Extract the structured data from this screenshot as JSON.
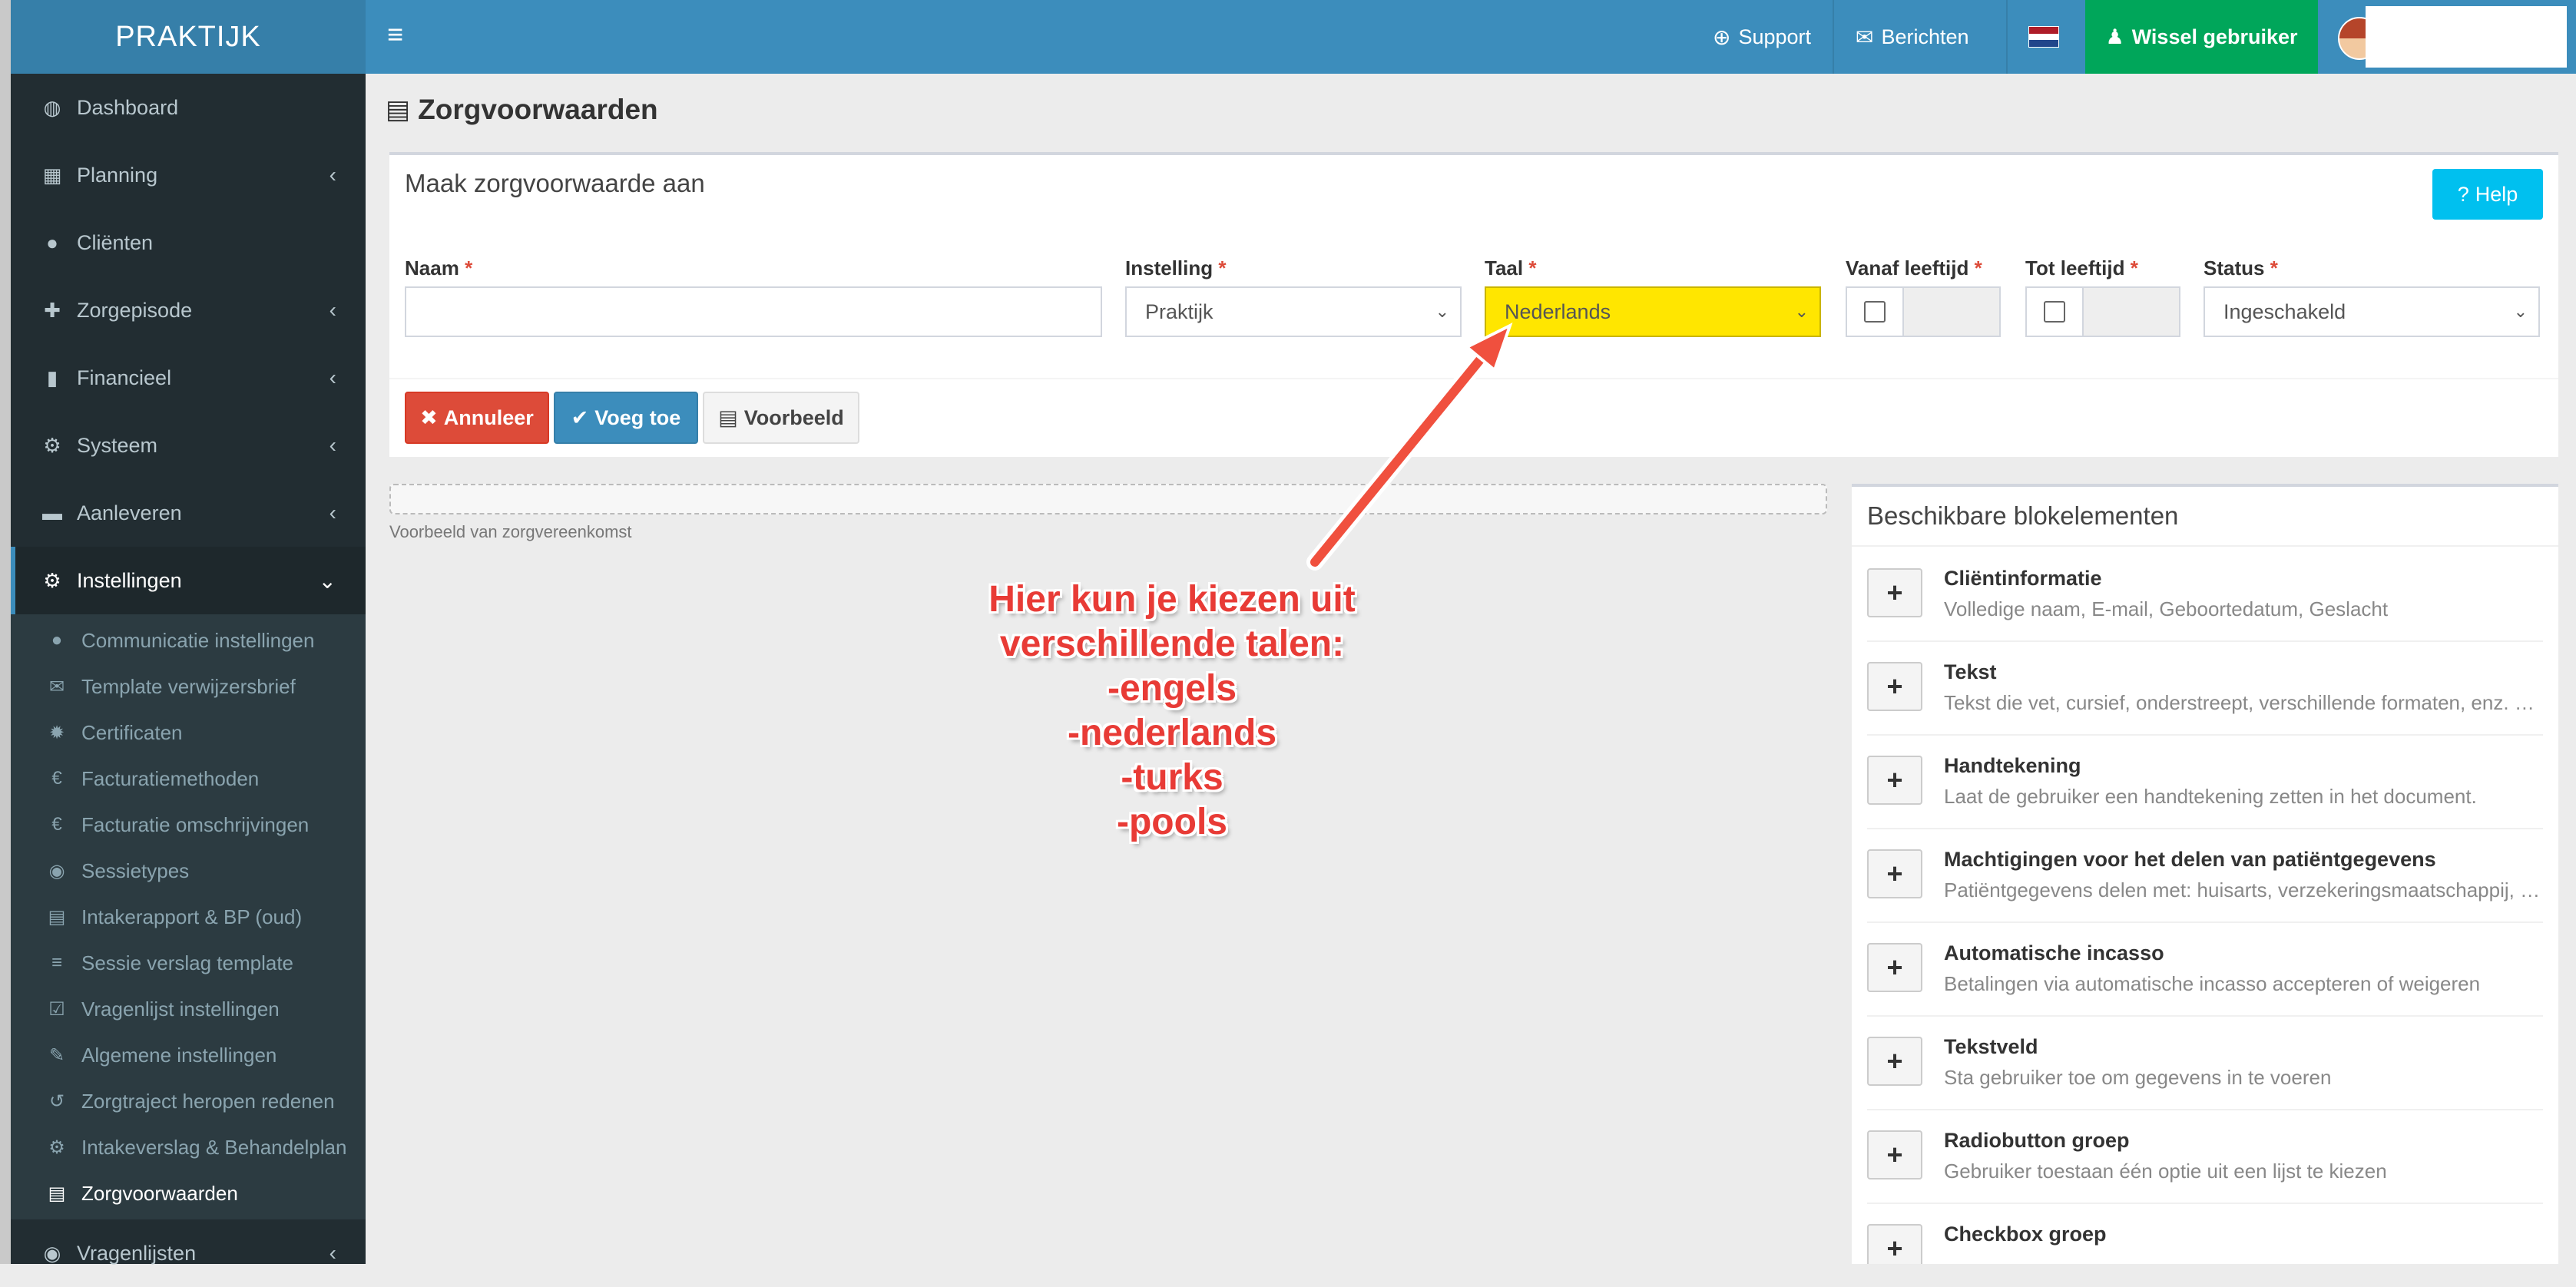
{
  "sidebar": {
    "brand": "PRAKTIJK",
    "items": [
      {
        "label": "Dashboard",
        "icon": "dashboard-icon",
        "glyph": "◍",
        "chevron": ""
      },
      {
        "label": "Planning",
        "icon": "calendar-icon",
        "glyph": "▦",
        "chevron": "‹"
      },
      {
        "label": "Cliënten",
        "icon": "user-icon",
        "glyph": "●",
        "chevron": ""
      },
      {
        "label": "Zorgepisode",
        "icon": "medkit-icon",
        "glyph": "✚",
        "chevron": "‹"
      },
      {
        "label": "Financieel",
        "icon": "book-icon",
        "glyph": "▮",
        "chevron": "‹"
      },
      {
        "label": "Systeem",
        "icon": "cogs-icon",
        "glyph": "⚙",
        "chevron": "‹"
      },
      {
        "label": "Aanleveren",
        "icon": "truck-icon",
        "glyph": "▬",
        "chevron": "‹"
      },
      {
        "label": "Instellingen",
        "icon": "gear-icon",
        "glyph": "⚙",
        "chevron": "⌄"
      }
    ],
    "submenu": [
      {
        "label": "Communicatie instellingen",
        "icon": "comments-icon",
        "glyph": "●"
      },
      {
        "label": "Template verwijzersbrief",
        "icon": "envelope-icon",
        "glyph": "✉"
      },
      {
        "label": "Certificaten",
        "icon": "certificate-icon",
        "glyph": "✹"
      },
      {
        "label": "Facturatiemethoden",
        "icon": "euro-icon",
        "glyph": "€"
      },
      {
        "label": "Facturatie omschrijvingen",
        "icon": "euro-icon",
        "glyph": "€"
      },
      {
        "label": "Sessietypes",
        "icon": "globe-icon",
        "glyph": "◉"
      },
      {
        "label": "Intakerapport & BP (oud)",
        "icon": "file-icon",
        "glyph": "▤"
      },
      {
        "label": "Sessie verslag template",
        "icon": "database-icon",
        "glyph": "≡"
      },
      {
        "label": "Vragenlijst instellingen",
        "icon": "check-square-icon",
        "glyph": "☑"
      },
      {
        "label": "Algemene instellingen",
        "icon": "wrench-icon",
        "glyph": "✎"
      },
      {
        "label": "Zorgtraject heropen redenen",
        "icon": "undo-icon",
        "glyph": "↺"
      },
      {
        "label": "Intakeverslag & Behandelplan",
        "icon": "cog-icon",
        "glyph": "⚙"
      },
      {
        "label": "Zorgvoorwaarden",
        "icon": "file-pdf-icon",
        "glyph": "▤"
      }
    ],
    "bottom_item": {
      "label": "Vragenlijsten",
      "icon": "globe-icon",
      "glyph": "◉",
      "chevron": "‹"
    }
  },
  "topbar": {
    "menu_glyph": "≡",
    "support": "Support",
    "support_glyph": "⊕",
    "berichten": "Berichten",
    "berichten_glyph": "✉",
    "wissel": "Wissel gebruiker",
    "wissel_glyph": "♟",
    "flag_colors": [
      "#ae1c28",
      "#ffffff",
      "#21468b"
    ]
  },
  "page": {
    "title": "Zorgvoorwaarden",
    "title_glyph": "▤"
  },
  "form": {
    "title": "Maak zorgvoorwaarde aan",
    "help": "Help",
    "help_glyph": "?",
    "naam_label": "Naam",
    "instelling_label": "Instelling",
    "instelling_value": "Praktijk",
    "taal_label": "Taal",
    "taal_value": "Nederlands",
    "vanaf_label": "Vanaf leeftijd",
    "tot_label": "Tot leeftijd",
    "status_label": "Status",
    "status_value": "Ingeschakeld",
    "required_mark": "*",
    "chevron": "⌄",
    "annuleer": "Annuleer",
    "annuleer_glyph": "✖",
    "voeg_toe": "Voeg toe",
    "voeg_toe_glyph": "✔",
    "voorbeeld": "Voorbeeld",
    "voorbeeld_glyph": "▤"
  },
  "preview": {
    "caption": "Voorbeeld van zorgvereenkomst"
  },
  "blocks": {
    "title": "Beschikbare blokelementen",
    "plus": "+",
    "items": [
      {
        "title": "Cliëntinformatie",
        "desc": "Volledige naam, E-mail, Geboortedatum, Geslacht"
      },
      {
        "title": "Tekst",
        "desc": "Tekst die vet, cursief, onderstreept, verschillende formaten, enz. bevat"
      },
      {
        "title": "Handtekening",
        "desc": "Laat de gebruiker een handtekening zetten in het document."
      },
      {
        "title": "Machtigingen voor het delen van patiëntgegevens",
        "desc": "Patiëntgegevens delen met: huisarts, verzekeringsmaatschappij, overige"
      },
      {
        "title": "Automatische incasso",
        "desc": "Betalingen via automatische incasso accepteren of weigeren"
      },
      {
        "title": "Tekstveld",
        "desc": "Sta gebruiker toe om gegevens in te voeren"
      },
      {
        "title": "Radiobutton groep",
        "desc": "Gebruiker toestaan één optie uit een lijst te kiezen"
      },
      {
        "title": "Checkbox groep",
        "desc": ""
      }
    ]
  },
  "annotation": {
    "lines": [
      "Hier kun je kiezen uit",
      "verschillende talen:",
      "-engels",
      "-nederlands",
      "-turks",
      "-pools"
    ],
    "color": "#e83b36",
    "highlight_color": "#ffe600"
  }
}
